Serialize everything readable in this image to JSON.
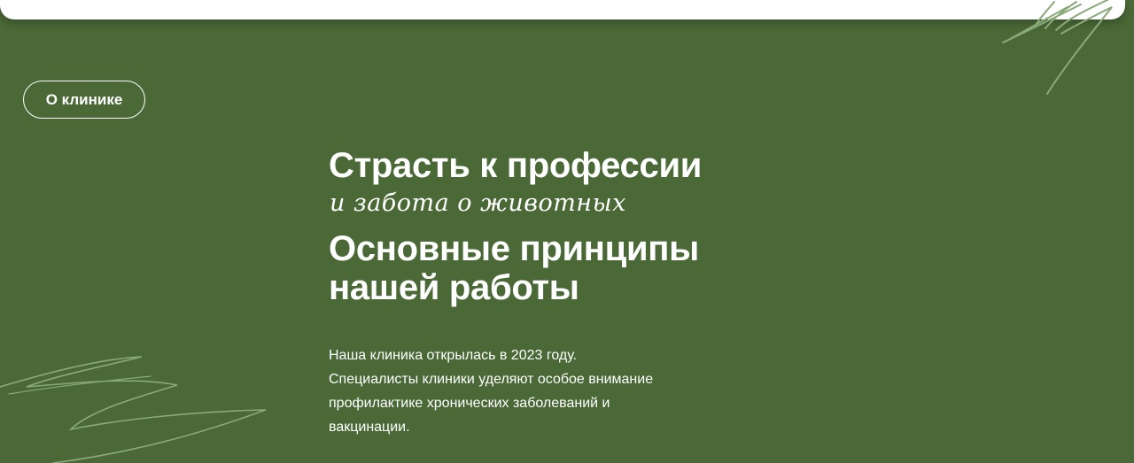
{
  "header": {
    "badge_label": "О клинике"
  },
  "hero": {
    "title_line_1": "Страсть к профессии",
    "script_line": "и забота о животных",
    "title_line_2": "Основные принципы",
    "title_line_3": "нашей работы"
  },
  "description": {
    "lines": [
      "Наша клиника открылась в 2023 году.",
      "Специалисты клиники уделяют особое внимание",
      "профилактике хронических заболеваний и",
      "вакцинации."
    ]
  },
  "colors": {
    "background": "#4a6937",
    "text": "#ffffff",
    "scribble": "#8aa979"
  }
}
